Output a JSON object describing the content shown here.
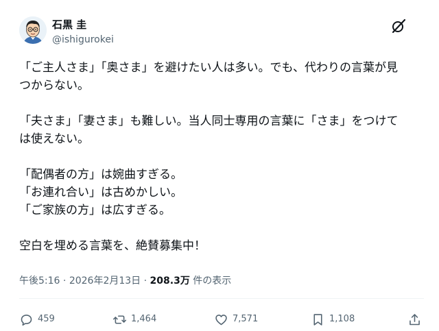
{
  "author": {
    "name": "石黒 圭",
    "handle": "@ishigurokei"
  },
  "post": {
    "paragraphs": [
      [
        "「ご主人さま」「奥さま」を避けたい人は多い。でも、代わりの言葉が見",
        "つからない。"
      ],
      [
        "「夫さま」「妻さま」も難しい。当人同士専用の言葉に「さま」をつけて",
        "は使えない。"
      ],
      [
        "「配偶者の方」は婉曲すぎる。",
        "「お連れ合い」は古めかしい。",
        "「ご家族の方」は広すぎる。"
      ],
      [
        "空白を埋める言葉を、絶賛募集中！"
      ]
    ]
  },
  "meta": {
    "time": "午後5:16",
    "date": "2026年2月13日",
    "separator": " · ",
    "views": "208.3万",
    "views_suffix": " 件の表示"
  },
  "actions": {
    "reply_count": "459",
    "retweet_count": "1,464",
    "like_count": "7,571",
    "bookmark_count": "1,108"
  },
  "icons": {
    "brand": "x-logo-icon",
    "reply": "speech-bubble-icon",
    "retweet": "retweet-arrows-icon",
    "like": "heart-icon",
    "bookmark": "bookmark-icon",
    "share": "share-upload-icon"
  },
  "colors": {
    "text_primary": "#0f1419",
    "text_secondary": "#536471",
    "divider": "#eff3f4"
  }
}
